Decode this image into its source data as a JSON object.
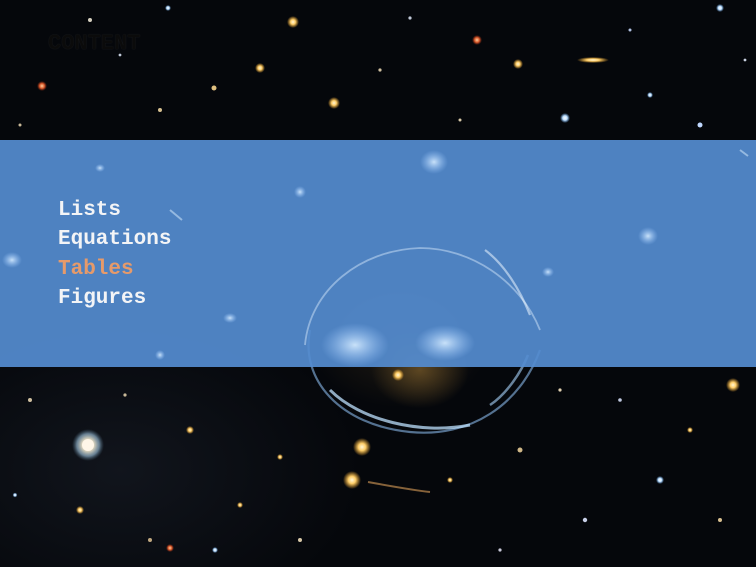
{
  "slide": {
    "title": "CONTENT",
    "menu": [
      {
        "label": "Lists",
        "active": false
      },
      {
        "label": "Equations",
        "active": false
      },
      {
        "label": "Tables",
        "active": true
      },
      {
        "label": "Figures",
        "active": false
      }
    ],
    "colors": {
      "band": "#548cd0",
      "active_item": "#e69a6a",
      "item": "#f3f4f6",
      "title": "#0b0b0b",
      "background": "#05070b"
    }
  }
}
